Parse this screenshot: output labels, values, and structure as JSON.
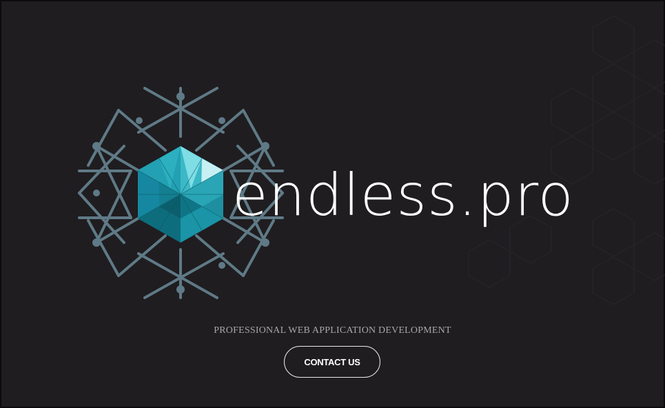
{
  "brand": {
    "wordmark": "endless.pro",
    "icon": "crystal-network-logo-icon"
  },
  "hero": {
    "tagline": "PROFESSIONAL WEB APPLICATION DEVELOPMENT",
    "contact_label": "CONTACT US"
  },
  "colors": {
    "background": "#1f1d20",
    "network_lines": "#5f7a86",
    "gem_dark": "#0e6d7d",
    "gem_mid": "#1b97a9",
    "gem_light": "#4fc6d2",
    "text": "#ffffff",
    "tagline": "#a9a6a8"
  }
}
